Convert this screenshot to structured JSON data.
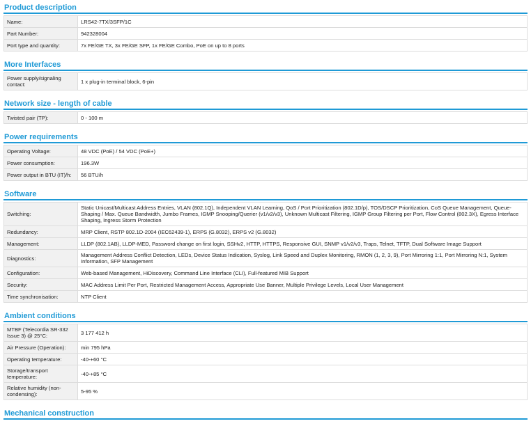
{
  "sections": [
    {
      "id": "product-description",
      "title": "Product description",
      "rows": [
        {
          "label": "Name:",
          "value": "LRS42-7TX/3SFP/1C"
        },
        {
          "label": "Part Number:",
          "value": "942328004"
        },
        {
          "label": "Port type and quantity:",
          "value": "7x FE/GE TX, 3x FE/GE SFP, 1x FE/GE Combo, PoE on up to 8 ports"
        }
      ]
    },
    {
      "id": "more-interfaces",
      "title": "More Interfaces",
      "rows": [
        {
          "label": "Power supply/signaling contact:",
          "value": "1 x plug-in terminal block, 6-pin"
        }
      ]
    },
    {
      "id": "network-size",
      "title": "Network size - length of cable",
      "rows": [
        {
          "label": "Twisted pair (TP):",
          "value": "0 - 100 m"
        }
      ]
    },
    {
      "id": "power-requirements",
      "title": "Power requirements",
      "rows": [
        {
          "label": "Operating Voltage:",
          "value": "48 VDC (PoE) / 54 VDC (PoE+)"
        },
        {
          "label": "Power consumption:",
          "value": "196.3W"
        },
        {
          "label": "Power output in BTU (IT)/h:",
          "value": "56 BTU/h"
        }
      ]
    },
    {
      "id": "software",
      "title": "Software",
      "rows": [
        {
          "label": "Switching:",
          "value": "Static Unicast/Multicast Address Entries, VLAN (802.1Q), Independent VLAN Learning, QoS / Port Prioritization (802.1D/p), TOS/DSCP Prioritization, CoS Queue Management, Queue-Shaping / Max. Queue Bandwidth, Jumbo Frames, IGMP Snooping/Querier (v1/v2/v3), Unknown Multicast Filtering, IGMP Group Filtering per Port, Flow Control (802.3X), Egress Interface Shaping, Ingress Storm Protection"
        },
        {
          "label": "Redundancy:",
          "value": "MRP Client, RSTP 802.1D-2004 (IEC62439-1), ERPS (G.8032), ERPS v2 (G.8032)"
        },
        {
          "label": "Management:",
          "value": "LLDP (802.1AB), LLDP-MED, Password change on first login, SSHv2, HTTP, HTTPS, Responsive GUI, SNMP v1/v2/v3, Traps, Telnet, TFTP, Dual Software Image Support"
        },
        {
          "label": "Diagnostics:",
          "value": "Management Address Conflict Detection, LEDs, Device Status Indication, Syslog, Link Speed and Duplex Monitoring, RMON (1, 2, 3, 9), Port Mirroring 1:1, Port Mirroring N:1, System Information, SFP Management"
        },
        {
          "label": "Configuration:",
          "value": "Web-based Management, HiDiscovery, Command Line Interface (CLI), Full-featured MIB Support"
        },
        {
          "label": "Security:",
          "value": "MAC Address Limit Per Port, Restricted Management Access, Appropriate Use Banner, Multiple Privilege Levels, Local User Management"
        },
        {
          "label": "Time synchronisation:",
          "value": "NTP Client"
        }
      ]
    },
    {
      "id": "ambient-conditions",
      "title": "Ambient conditions",
      "rows": [
        {
          "label": "MTBF (Telecordia SR-332 Issue 3) @ 25°C:",
          "value": "3 177 412 h"
        },
        {
          "label": "Air Pressure (Operation):",
          "value": "min 795 hPa"
        },
        {
          "label": "Operating temperature:",
          "value": "-40-+60 °C"
        },
        {
          "label": "Storage/transport temperature:",
          "value": "-40-+85 °C"
        },
        {
          "label": "Relative humidity (non-condensing):",
          "value": "5-95 %"
        }
      ]
    },
    {
      "id": "mechanical-construction",
      "title": "Mechanical construction",
      "rows": []
    }
  ],
  "colors": {
    "accent": "#1f9ad6",
    "label_bg": "#f1f1f1",
    "border": "#dcdcdc"
  }
}
